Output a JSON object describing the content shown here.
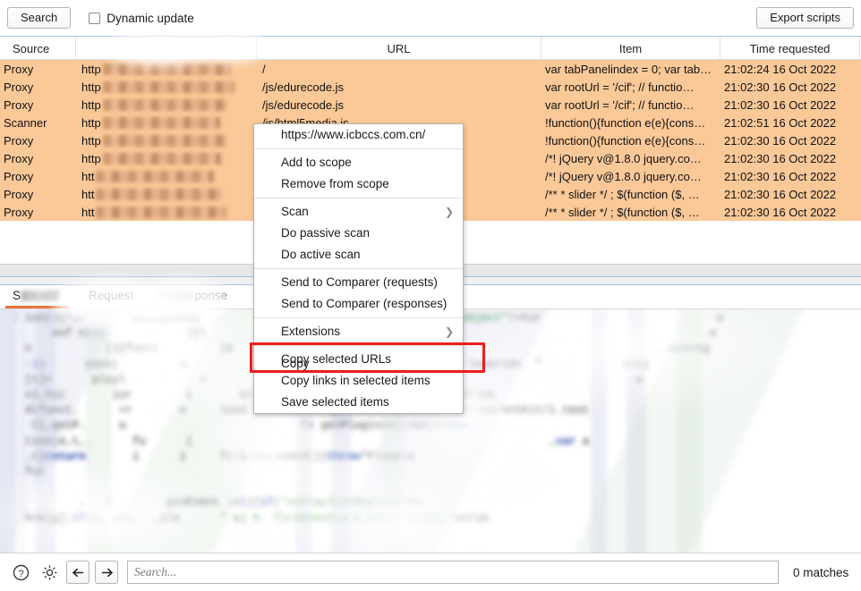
{
  "toolbar": {
    "search_label": "Search",
    "dynamic_update_label": "Dynamic update",
    "dynamic_update_checked": false,
    "export_label": "Export scripts"
  },
  "table": {
    "columns": [
      "Source",
      "",
      "URL",
      "Item",
      "Time requested"
    ],
    "rows": [
      {
        "source": "Proxy",
        "host": "http",
        "url": "/",
        "item": "var tabPanelindex = 0; var tab…",
        "time": "21:02:24 16 Oct 2022"
      },
      {
        "source": "Proxy",
        "host": "http",
        "url": "/js/edurecode.js",
        "item": "var rootUrl = '/cif'; // functio…",
        "time": "21:02:30 16 Oct 2022"
      },
      {
        "source": "Proxy",
        "host": "http",
        "url": "/js/edurecode.js",
        "item": "var rootUrl = '/cif'; // functio…",
        "time": "21:02:30 16 Oct 2022"
      },
      {
        "source": "Scanner",
        "host": "http",
        "url": "/js/html5media.js",
        "item": "!function(){function e(e){cons…",
        "time": "21:02:51 16 Oct 2022"
      },
      {
        "source": "Proxy",
        "host": "http",
        "url": "",
        "item": "!function(){function e(e){cons…",
        "time": "21:02:30 16 Oct 2022"
      },
      {
        "source": "Proxy",
        "host": "http",
        "url": "",
        "item": "/*! jQuery v@1.8.0 jquery.co…",
        "time": "21:02:30 16 Oct 2022"
      },
      {
        "source": "Proxy",
        "host": "htt",
        "url": "",
        "item": "/*! jQuery v@1.8.0 jquery.co…",
        "time": "21:02:30 16 Oct 2022"
      },
      {
        "source": "Proxy",
        "host": "htt",
        "url": "",
        "item": "/** * slider */ ; $(function ($, …",
        "time": "21:02:30 16 Oct 2022"
      },
      {
        "source": "Proxy",
        "host": "htt",
        "url": "",
        "item": "/** * slider */ ; $(function ($, …",
        "time": "21:02:30 16 Oct 2022"
      }
    ]
  },
  "context_menu": {
    "groups": [
      {
        "items": [
          {
            "label": "https://www.icbccs.com.cn/",
            "submenu": false
          }
        ]
      },
      {
        "items": [
          {
            "label": "Add to scope",
            "submenu": false
          },
          {
            "label": "Remove from scope",
            "submenu": false
          }
        ]
      },
      {
        "items": [
          {
            "label": "Scan",
            "submenu": true
          },
          {
            "label": "Do passive scan",
            "submenu": false
          },
          {
            "label": "Do active scan",
            "submenu": false
          }
        ]
      },
      {
        "items": [
          {
            "label": "Send to Comparer (requests)",
            "submenu": false
          },
          {
            "label": "Send to Comparer (responses)",
            "submenu": false
          }
        ]
      },
      {
        "items": [
          {
            "label": "Extensions",
            "submenu": true
          }
        ]
      },
      {
        "items": [
          {
            "label": "Copy selected URLs",
            "submenu": false
          },
          {
            "label": "Copy links in selected items",
            "submenu": false
          },
          {
            "label": "Save selected items",
            "submenu": false
          }
        ]
      }
    ],
    "overlap_artifact_label": "Copy",
    "highlighted_item": "Copy links in selected items",
    "highlight_color": "#ee1d1d"
  },
  "bottom_panel": {
    "tabs": [
      {
        "label": "S",
        "obscured": true,
        "selected": true
      },
      {
        "label": "Request",
        "obscured": false,
        "selected": false
      },
      {
        "label": "ponse",
        "obscured": true,
        "selected": false
      }
    ],
    "line_number": "1",
    "code_fragments": [
      "ion(){fun       e(e){conso                                 '|'||\"object\"!=tur                          u",
      "    eof n||(            )}\\          fun                                                             .e",
      "n           (){funct         (e       t=                                                      ..userAg",
      "-1)      eInt(         e.         ,1                              lower1d=  \"            ==ty",
      "[t]=      playl           =        w                                                       e",
      "o},hic       ior        t       &(o.style.height=\"0px\"),S.isLoaded()&&",
      "d(funct.      +r       n     load:function(e){if(this.isFullScreen()&&/WebKit/i.test",
      " C},getP.     u                          fn getPlugin(e);n&&(t=new",
      "tion(e,t,.      fu      (                                                     ,var a",
      ",t}return       i      i     f(!S.isLoaded())throw\"Flowpla",
      "fur",
      "",
      "        ,   /        ginEvent :=1){if(\"onPlaylistReplace\"==",
      "h=k[g];if(h) urn   _ire      \" o) h. fireEvent(a,t.slice(3))}},\"strin"
    ]
  },
  "status_bar": {
    "help_icon": "question-circle-icon",
    "settings_icon": "gear-icon",
    "back_label": "←",
    "forward_label": "→",
    "search_placeholder": "Search...",
    "search_value": "",
    "matches_label": "0 matches"
  },
  "colors": {
    "row_highlight": "#fbc898",
    "tab_accent": "#e8743b",
    "highlight_box": "#ee1d1d",
    "table_border": "#a7c0db"
  }
}
